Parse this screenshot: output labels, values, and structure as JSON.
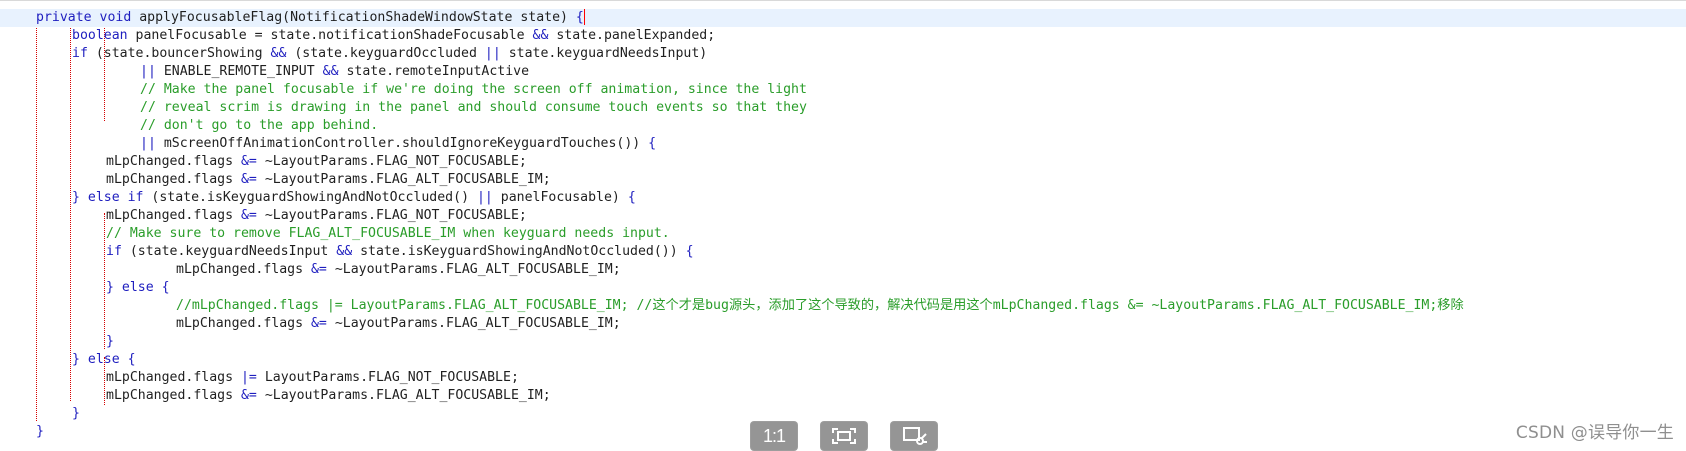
{
  "code": {
    "lines": [
      {
        "class": "current",
        "indent": "",
        "parts": [
          {
            "c": "kw",
            "t": "private "
          },
          {
            "c": "ty",
            "t": "void "
          },
          {
            "c": "id",
            "t": "applyFocusableFlag(NotificationShadeWindowState state) "
          },
          {
            "c": "op",
            "t": "{"
          }
        ],
        "cursor": true
      },
      {
        "indent": "indent-1",
        "parts": [
          {
            "c": "ty",
            "t": "boolean "
          },
          {
            "c": "id",
            "t": "panelFocusable = state.notificationShadeFocusable "
          },
          {
            "c": "op",
            "t": "&& "
          },
          {
            "c": "id",
            "t": "state.panelExpanded;"
          }
        ]
      },
      {
        "indent": "indent-1",
        "parts": [
          {
            "c": "kw",
            "t": "if "
          },
          {
            "c": "id",
            "t": "(state.bouncerShowing "
          },
          {
            "c": "op",
            "t": "&& "
          },
          {
            "c": "id",
            "t": "(state.keyguardOccluded "
          },
          {
            "c": "op",
            "t": "|| "
          },
          {
            "c": "id",
            "t": "state.keyguardNeedsInput)"
          }
        ]
      },
      {
        "indent": "indent-3",
        "parts": [
          {
            "c": "op",
            "t": "|| "
          },
          {
            "c": "id",
            "t": "ENABLE_REMOTE_INPUT "
          },
          {
            "c": "op",
            "t": "&& "
          },
          {
            "c": "id",
            "t": "state.remoteInputActive"
          }
        ]
      },
      {
        "indent": "indent-3",
        "parts": [
          {
            "c": "cm",
            "t": "// Make the panel focusable if we're doing the screen off animation, since the light"
          }
        ]
      },
      {
        "indent": "indent-3",
        "parts": [
          {
            "c": "cm",
            "t": "// reveal scrim is drawing in the panel and should consume touch events so that they"
          }
        ]
      },
      {
        "indent": "indent-3",
        "parts": [
          {
            "c": "cm",
            "t": "// don't go to the app behind."
          }
        ]
      },
      {
        "indent": "indent-3",
        "parts": [
          {
            "c": "op",
            "t": "|| "
          },
          {
            "c": "id",
            "t": "mScreenOffAnimationController.shouldIgnoreKeyguardTouches()) "
          },
          {
            "c": "op",
            "t": "{"
          }
        ]
      },
      {
        "indent": "indent-2",
        "parts": [
          {
            "c": "id",
            "t": "mLpChanged.flags "
          },
          {
            "c": "op",
            "t": "&= "
          },
          {
            "c": "id",
            "t": "~LayoutParams.FLAG_NOT_FOCUSABLE;"
          }
        ]
      },
      {
        "indent": "indent-2",
        "parts": [
          {
            "c": "id",
            "t": "mLpChanged.flags "
          },
          {
            "c": "op",
            "t": "&= "
          },
          {
            "c": "id",
            "t": "~LayoutParams.FLAG_ALT_FOCUSABLE_IM;"
          }
        ]
      },
      {
        "indent": "indent-1",
        "parts": [
          {
            "c": "op",
            "t": "} "
          },
          {
            "c": "kw",
            "t": "else if "
          },
          {
            "c": "id",
            "t": "(state.isKeyguardShowingAndNotOccluded() "
          },
          {
            "c": "op",
            "t": "|| "
          },
          {
            "c": "id",
            "t": "panelFocusable) "
          },
          {
            "c": "op",
            "t": "{"
          }
        ]
      },
      {
        "indent": "indent-2",
        "parts": [
          {
            "c": "id",
            "t": "mLpChanged.flags "
          },
          {
            "c": "op",
            "t": "&= "
          },
          {
            "c": "id",
            "t": "~LayoutParams.FLAG_NOT_FOCUSABLE;"
          }
        ]
      },
      {
        "indent": "indent-2",
        "parts": [
          {
            "c": "cm",
            "t": "// Make sure to remove FLAG_ALT_FOCUSABLE_IM when keyguard needs input."
          }
        ]
      },
      {
        "indent": "indent-2",
        "parts": [
          {
            "c": "kw",
            "t": "if "
          },
          {
            "c": "id",
            "t": "(state.keyguardNeedsInput "
          },
          {
            "c": "op",
            "t": "&& "
          },
          {
            "c": "id",
            "t": "state.isKeyguardShowingAndNotOccluded()) "
          },
          {
            "c": "op",
            "t": "{"
          }
        ]
      },
      {
        "indent": "indent-4",
        "parts": [
          {
            "c": "id",
            "t": "mLpChanged.flags "
          },
          {
            "c": "op",
            "t": "&= "
          },
          {
            "c": "id",
            "t": "~LayoutParams.FLAG_ALT_FOCUSABLE_IM;"
          }
        ]
      },
      {
        "indent": "indent-2",
        "parts": [
          {
            "c": "op",
            "t": "} "
          },
          {
            "c": "kw",
            "t": "else "
          },
          {
            "c": "op",
            "t": "{"
          }
        ]
      },
      {
        "indent": "indent-4",
        "parts": [
          {
            "c": "cm",
            "t": "//mLpChanged.flags |= LayoutParams.FLAG_ALT_FOCUSABLE_IM; //这个才是bug源头，添加了这个导致的，解决代码是用这个mLpChanged.flags &= ~LayoutParams.FLAG_ALT_FOCUSABLE_IM;移除"
          }
        ]
      },
      {
        "indent": "indent-4",
        "parts": [
          {
            "c": "id",
            "t": "mLpChanged.flags "
          },
          {
            "c": "op",
            "t": "&= "
          },
          {
            "c": "id",
            "t": "~LayoutParams.FLAG_ALT_FOCUSABLE_IM;"
          }
        ]
      },
      {
        "indent": "indent-2",
        "parts": [
          {
            "c": "op",
            "t": "}"
          }
        ]
      },
      {
        "indent": "indent-1",
        "parts": [
          {
            "c": "op",
            "t": "} "
          },
          {
            "c": "kw",
            "t": "else "
          },
          {
            "c": "op",
            "t": "{"
          }
        ]
      },
      {
        "indent": "indent-2",
        "parts": [
          {
            "c": "id",
            "t": "mLpChanged.flags "
          },
          {
            "c": "op",
            "t": "|= "
          },
          {
            "c": "id",
            "t": "LayoutParams.FLAG_NOT_FOCUSABLE;"
          }
        ]
      },
      {
        "indent": "indent-2",
        "parts": [
          {
            "c": "id",
            "t": "mLpChanged.flags "
          },
          {
            "c": "op",
            "t": "&= "
          },
          {
            "c": "id",
            "t": "~LayoutParams.FLAG_ALT_FOCUSABLE_IM;"
          }
        ]
      },
      {
        "indent": "indent-1",
        "parts": [
          {
            "c": "op",
            "t": "}"
          }
        ]
      },
      {
        "indent": "",
        "parts": [
          {
            "c": "op",
            "t": "}"
          }
        ]
      }
    ]
  },
  "overlay": {
    "actual_size_label": "1:1",
    "fit_icon": "fit-screen-icon",
    "crop_icon": "crop-image-icon"
  },
  "watermark": {
    "text": "CSDN @误导你一生"
  },
  "colors": {
    "keyword": "#1e1ebf",
    "comment": "#2a9d2a",
    "text": "#1f1f1f",
    "current_line": "#e8f2fe",
    "guide": "#d60000",
    "overlay_button": "#8d8d8d",
    "watermark": "#8f8f8f"
  }
}
